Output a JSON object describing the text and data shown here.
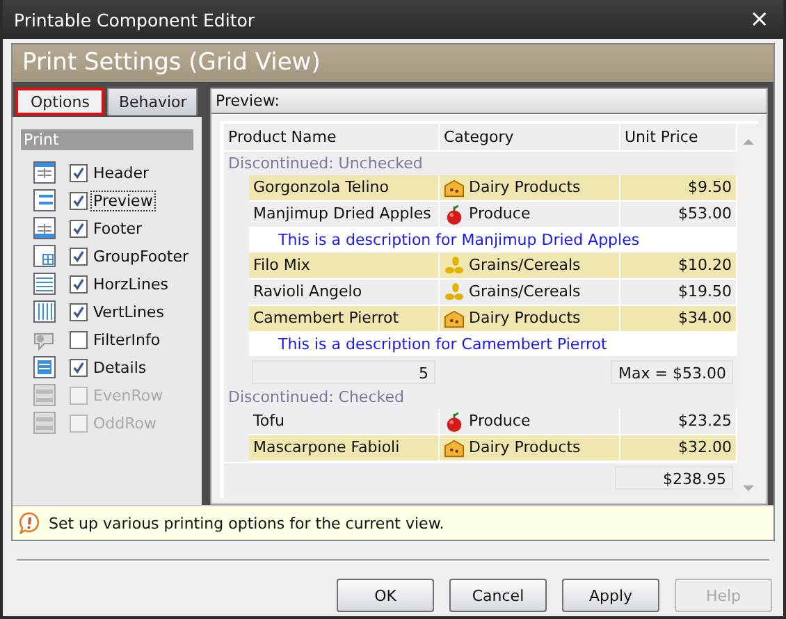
{
  "window": {
    "title": "Printable Component Editor",
    "close": "×"
  },
  "header": {
    "title": "Print Settings (Grid View)"
  },
  "tabs": [
    {
      "label": "Options",
      "selected": true
    },
    {
      "label": "Behavior",
      "selected": false
    }
  ],
  "options": {
    "title": "Print",
    "items": [
      {
        "label": "Header",
        "checked": true,
        "disabled": false,
        "focused": false
      },
      {
        "label": "Preview",
        "checked": true,
        "disabled": false,
        "focused": true
      },
      {
        "label": "Footer",
        "checked": true,
        "disabled": false,
        "focused": false
      },
      {
        "label": "GroupFooter",
        "checked": true,
        "disabled": false,
        "focused": false
      },
      {
        "label": "HorzLines",
        "checked": true,
        "disabled": false,
        "focused": false
      },
      {
        "label": "VertLines",
        "checked": true,
        "disabled": false,
        "focused": false
      },
      {
        "label": "FilterInfo",
        "checked": false,
        "disabled": false,
        "focused": false
      },
      {
        "label": "Details",
        "checked": true,
        "disabled": false,
        "focused": false
      },
      {
        "label": "EvenRow",
        "checked": false,
        "disabled": true,
        "focused": false
      },
      {
        "label": "OddRow",
        "checked": false,
        "disabled": true,
        "focused": false
      }
    ]
  },
  "preview": {
    "title": "Preview:",
    "columns": [
      "Product Name",
      "Category",
      "Unit Price"
    ],
    "rows": [
      {
        "kind": "group",
        "text": "Discontinued: Unchecked"
      },
      {
        "kind": "data",
        "name": "Gorgonzola Telino",
        "category": {
          "kind": "cheese",
          "text": "Dairy Products"
        },
        "price": "$9.50",
        "highlighted": true
      },
      {
        "kind": "data",
        "name": "Manjimup Dried Apples",
        "category": {
          "kind": "apple",
          "text": "Produce"
        },
        "price": "$53.00",
        "highlighted": false
      },
      {
        "kind": "description",
        "text": "This is a description for Manjimup Dried Apples"
      },
      {
        "kind": "data",
        "name": "Filo Mix",
        "category": {
          "kind": "grain",
          "text": "Grains/Cereals"
        },
        "price": "$10.20",
        "highlighted": true
      },
      {
        "kind": "data",
        "name": "Ravioli Angelo",
        "category": {
          "kind": "grain",
          "text": "Grains/Cereals"
        },
        "price": "$19.50",
        "highlighted": false
      },
      {
        "kind": "data",
        "name": "Camembert Pierrot",
        "category": {
          "kind": "cheese",
          "text": "Dairy Products"
        },
        "price": "$34.00",
        "highlighted": true
      },
      {
        "kind": "description",
        "text": "This is a description for Camembert Pierrot"
      },
      {
        "kind": "summary",
        "count": "5",
        "value": "Max = $53.00"
      },
      {
        "kind": "group",
        "text": "Discontinued: Checked"
      },
      {
        "kind": "data",
        "name": "Tofu",
        "category": {
          "kind": "apple",
          "text": "Produce"
        },
        "price": "$23.25",
        "highlighted": false
      },
      {
        "kind": "data",
        "name": "Mascarpone Fabioli",
        "category": {
          "kind": "cheese",
          "text": "Dairy Products"
        },
        "price": "$32.00",
        "highlighted": true
      },
      {
        "kind": "total",
        "value": "$238.95"
      }
    ]
  },
  "hint": "Set up various printing options for the current view.",
  "buttons": [
    {
      "label": "OK",
      "disabled": false
    },
    {
      "label": "Cancel",
      "disabled": false
    },
    {
      "label": "Apply",
      "disabled": false
    },
    {
      "label": "Help",
      "disabled": true
    }
  ]
}
